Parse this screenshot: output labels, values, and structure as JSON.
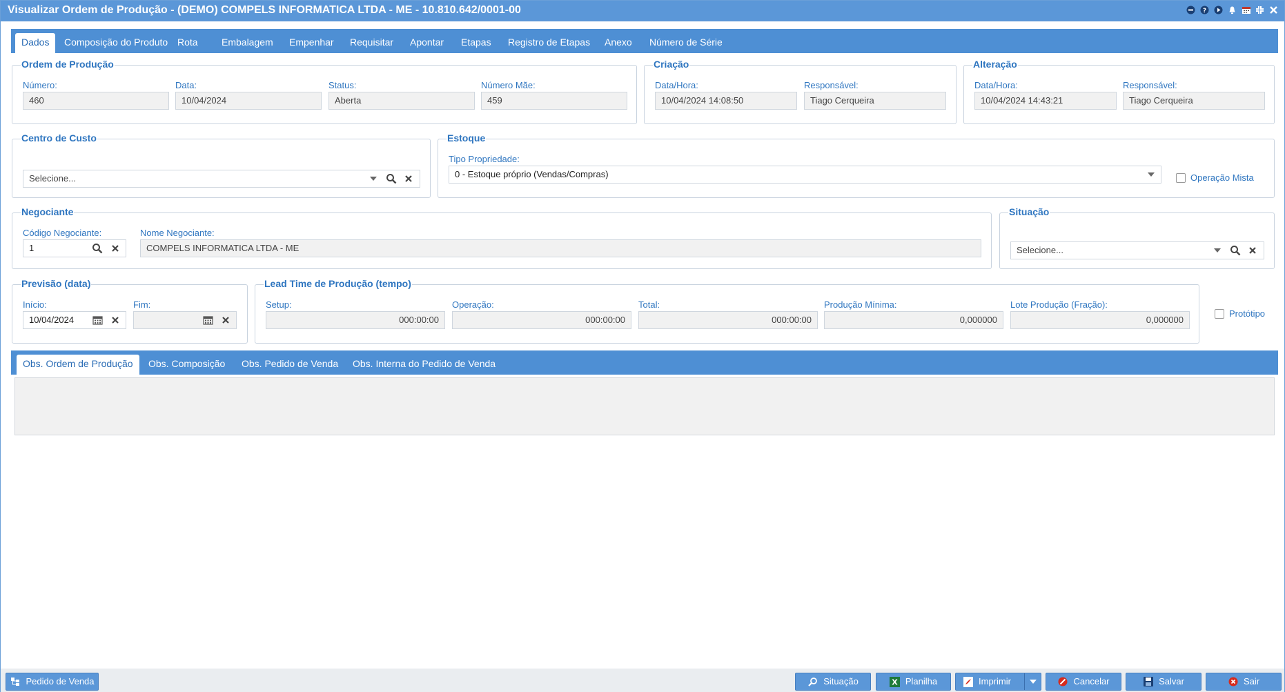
{
  "window": {
    "title": "Visualizar Ordem de Produção - (DEMO) COMPELS INFORMATICA LTDA - ME - 10.810.642/0001-00",
    "icons": [
      "minimize-icon",
      "help-icon",
      "play-icon",
      "notification-icon",
      "calendar-icon",
      "restore-icon",
      "close-icon"
    ]
  },
  "tabs": [
    "Dados",
    "Composição do Produto",
    "Rota",
    "Embalagem",
    "Empenhar",
    "Requisitar",
    "Apontar",
    "Etapas",
    "Registro de Etapas",
    "Anexo",
    "Número de Série"
  ],
  "ordem": {
    "legend": "Ordem de Produção",
    "numero_label": "Número:",
    "numero": "460",
    "data_label": "Data:",
    "data": "10/04/2024",
    "status_label": "Status:",
    "status": "Aberta",
    "mae_label": "Número Mãe:",
    "mae": "459"
  },
  "criacao": {
    "legend": "Criação",
    "datahora_label": "Data/Hora:",
    "datahora": "10/04/2024 14:08:50",
    "resp_label": "Responsável:",
    "resp": "Tiago Cerqueira"
  },
  "alteracao": {
    "legend": "Alteração",
    "datahora_label": "Data/Hora:",
    "datahora": "10/04/2024 14:43:21",
    "resp_label": "Responsável:",
    "resp": "Tiago Cerqueira"
  },
  "centro": {
    "legend": "Centro de Custo",
    "placeholder": "Selecione..."
  },
  "estoque": {
    "legend": "Estoque",
    "tipo_label": "Tipo Propriedade:",
    "tipo_value": "0 - Estoque próprio (Vendas/Compras)",
    "mista_label": "Operação Mista"
  },
  "negociante": {
    "legend": "Negociante",
    "codigo_label": "Código Negociante:",
    "codigo": "1",
    "nome_label": "Nome Negociante:",
    "nome": "COMPELS INFORMATICA LTDA - ME"
  },
  "situacao": {
    "legend": "Situação",
    "placeholder": "Selecione..."
  },
  "previsao": {
    "legend": "Previsão (data)",
    "inicio_label": "Início:",
    "inicio": "10/04/2024",
    "fim_label": "Fim:",
    "fim": ""
  },
  "leadtime": {
    "legend": "Lead Time de Produção (tempo)",
    "setup_label": "Setup:",
    "setup": "000:00:00",
    "operacao_label": "Operação:",
    "operacao": "000:00:00",
    "total_label": "Total:",
    "total": "000:00:00",
    "minima_label": "Produção Mínima:",
    "minima": "0,000000",
    "lote_label": "Lote Produção (Fração):",
    "lote": "0,000000"
  },
  "prototipo_label": "Protótipo",
  "obs_tabs": [
    "Obs. Ordem de Produção",
    "Obs. Composição",
    "Obs. Pedido de Venda",
    "Obs. Interna do Pedido de Venda"
  ],
  "footer": {
    "pedido": "Pedido de Venda",
    "situacao": "Situação",
    "planilha": "Planilha",
    "imprimir": "Imprimir",
    "cancelar": "Cancelar",
    "salvar": "Salvar",
    "sair": "Sair"
  },
  "colors": {
    "accent": "#4e8fd4",
    "title_bar": "#5b97d8",
    "label": "#2f76c0",
    "field_bg": "#f1f1f1"
  }
}
